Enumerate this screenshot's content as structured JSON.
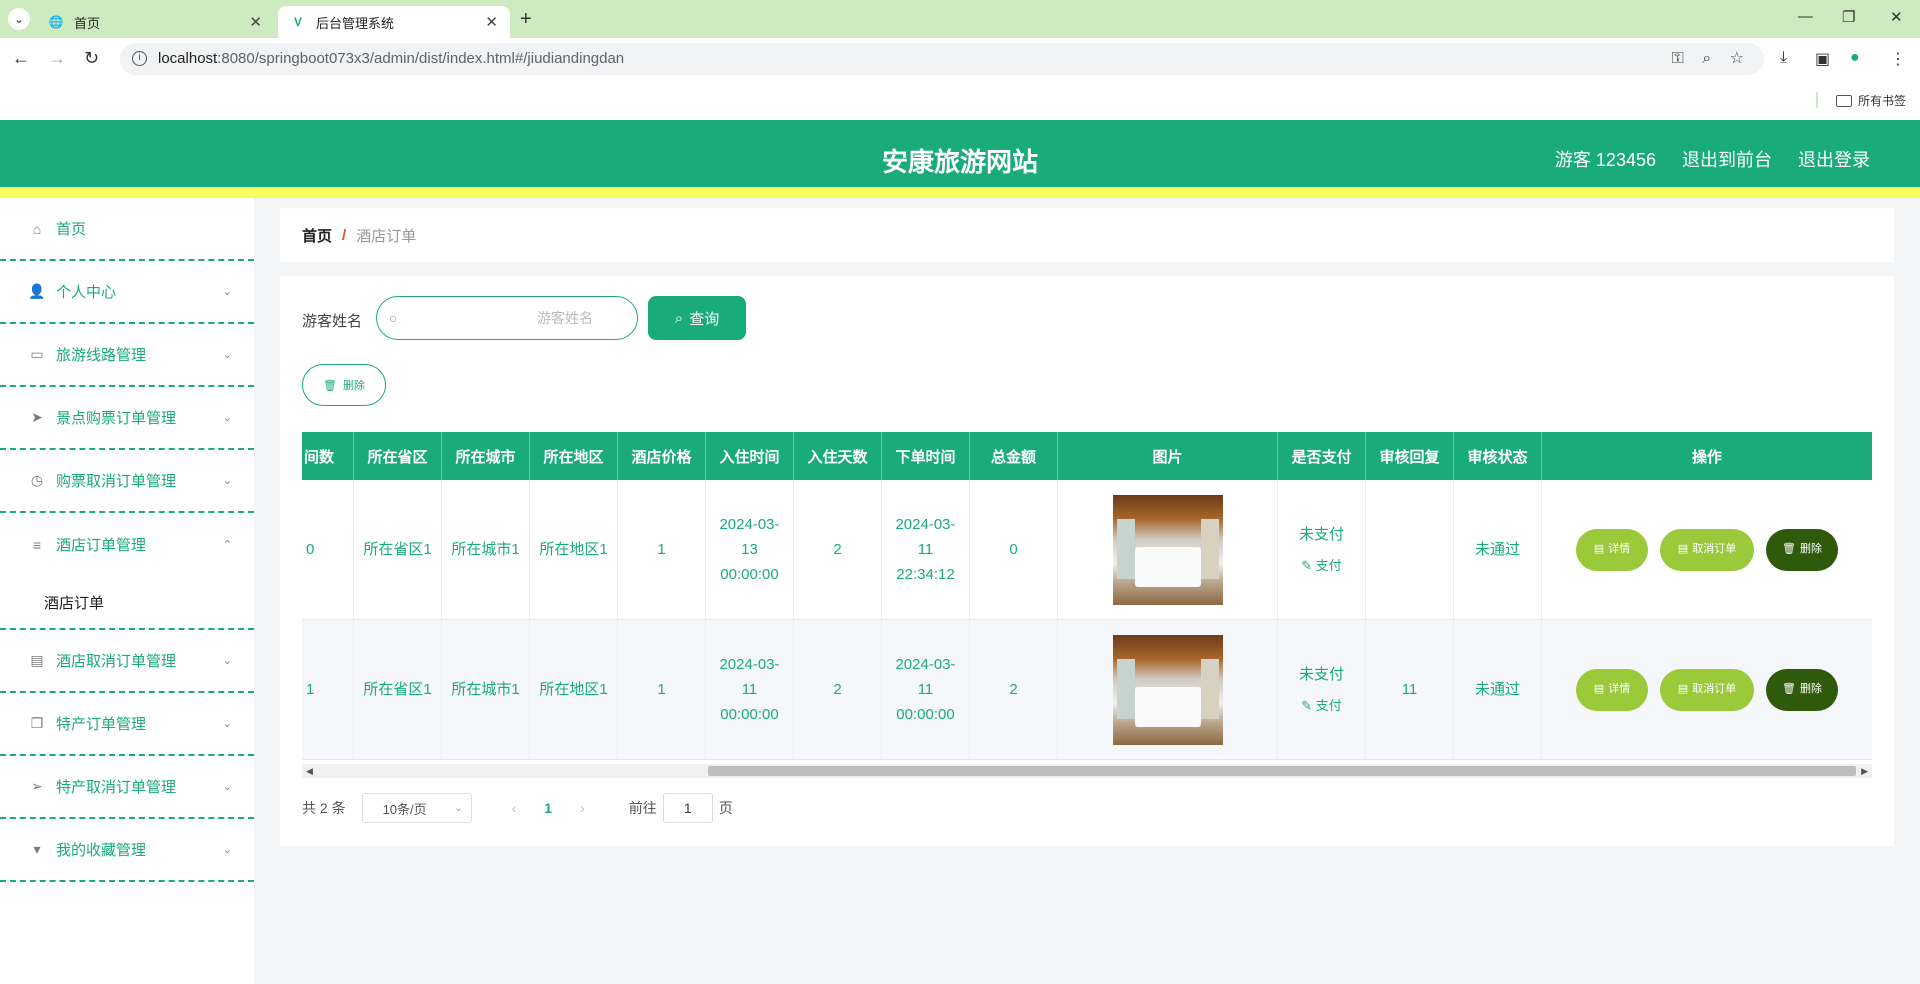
{
  "browser": {
    "tabs": [
      {
        "title": "首页",
        "active": false
      },
      {
        "title": "后台管理系统",
        "active": true
      }
    ],
    "url_host": "localhost",
    "url_path": ":8080/springboot073x3/admin/dist/index.html#/jiudiandingdan",
    "bookmarks_label": "所有书签"
  },
  "header": {
    "title": "安康旅游网站",
    "user": "游客 123456",
    "back_to_front": "退出到前台",
    "logout": "退出登录"
  },
  "sidebar": {
    "items": [
      {
        "label": "首页",
        "icon": "home-icon"
      },
      {
        "label": "个人中心",
        "icon": "user-icon"
      },
      {
        "label": "旅游线路管理",
        "icon": "chat-icon"
      },
      {
        "label": "景点购票订单管理",
        "icon": "send-icon"
      },
      {
        "label": "购票取消订单管理",
        "icon": "clock-icon"
      },
      {
        "label": "酒店订单管理",
        "icon": "list-icon",
        "expanded": true
      },
      {
        "label": "酒店取消订单管理",
        "icon": "clipboard-icon"
      },
      {
        "label": "特产订单管理",
        "icon": "copy-icon"
      },
      {
        "label": "特产取消订单管理",
        "icon": "plane-icon"
      },
      {
        "label": "我的收藏管理",
        "icon": "brush-icon"
      }
    ],
    "submenu_active": "酒店订单"
  },
  "breadcrumb": {
    "home": "首页",
    "sep": "/",
    "current": "酒店订单"
  },
  "search": {
    "label": "游客姓名",
    "placeholder": "游客姓名",
    "button": "查询"
  },
  "delete_button": "删除",
  "table": {
    "headers": [
      "间数",
      "所在省区",
      "所在城市",
      "所在地区",
      "酒店价格",
      "入住时间",
      "入住天数",
      "下单时间",
      "总金额",
      "图片",
      "是否支付",
      "审核回复",
      "审核状态",
      "操作"
    ],
    "rows": [
      {
        "rooms": "0",
        "province": "所在省区1",
        "city": "所在城市1",
        "district": "所在地区1",
        "price": "1",
        "checkin": "2024-03-13 00:00:00",
        "days": "2",
        "order_time": "2024-03-11 22:34:12",
        "total": "0",
        "paid": "未支付",
        "pay_link": "支付",
        "reply": "",
        "status": "未通过"
      },
      {
        "rooms": "1",
        "province": "所在省区1",
        "city": "所在城市1",
        "district": "所在地区1",
        "price": "1",
        "checkin": "2024-03-11 00:00:00",
        "days": "2",
        "order_time": "2024-03-11 00:00:00",
        "total": "2",
        "paid": "未支付",
        "pay_link": "支付",
        "reply": "11",
        "status": "未通过"
      }
    ],
    "ops": {
      "detail": "详情",
      "cancel": "取消订单",
      "delete": "删除"
    }
  },
  "pagination": {
    "total": "共 2 条",
    "page_size": "10条/页",
    "current": "1",
    "goto_prefix": "前往",
    "goto_value": "1",
    "goto_suffix": "页"
  },
  "colors": {
    "primary": "#1aab7a",
    "accent_yellow": "#f7ff5e",
    "op_green": "#9ac93a",
    "op_dark": "#2f5a0b"
  }
}
